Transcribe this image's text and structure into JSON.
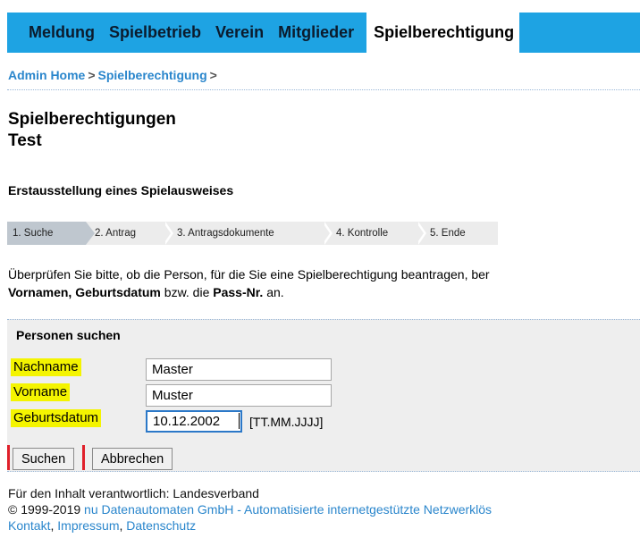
{
  "nav": {
    "items": [
      "Meldung",
      "Spielbetrieb",
      "Verein",
      "Mitglieder"
    ],
    "active": "Spielberechtigung"
  },
  "breadcrumb": {
    "home": "Admin Home",
    "separator": ">",
    "current": "Spielberechtigung"
  },
  "page": {
    "title_line1": "Spielberechtigungen",
    "title_line2": "Test",
    "subheading": "Erstausstellung eines Spielausweises"
  },
  "steps": [
    "1. Suche",
    "2. Antrag",
    "3. Antragsdokumente",
    "4. Kontrolle",
    "5. Ende"
  ],
  "intro": {
    "line1": "Überprüfen Sie bitte, ob die Person, für die Sie eine Spielberechtigung beantragen, ber",
    "bold1": "Vornamen, Geburtsdatum",
    "mid": " bzw. die ",
    "bold2": "Pass-Nr.",
    "end": " an."
  },
  "search": {
    "title": "Personen suchen",
    "fields": {
      "nachname": {
        "label": "Nachname",
        "value": "Master"
      },
      "vorname": {
        "label": "Vorname",
        "value": "Muster"
      },
      "geburtsdatum": {
        "label": "Geburtsdatum",
        "value": "10.12.2002",
        "format": "[TT.MM.JJJJ]"
      }
    },
    "buttons": {
      "search": "Suchen",
      "cancel": "Abbrechen"
    }
  },
  "footer": {
    "responsible": "Für den Inhalt verantwortlich: Landesverband",
    "copyright": "© 1999-2019",
    "company_link": "nu Datenautomaten GmbH - Automatisierte internetgestützte Netzwerklös",
    "links": [
      "Kontakt",
      "Impressum",
      "Datenschutz"
    ]
  },
  "colors": {
    "nav_bg": "#1ea3e3",
    "link": "#2a86cc",
    "highlight": "#f4f400",
    "annotation_red": "#e0202a"
  }
}
